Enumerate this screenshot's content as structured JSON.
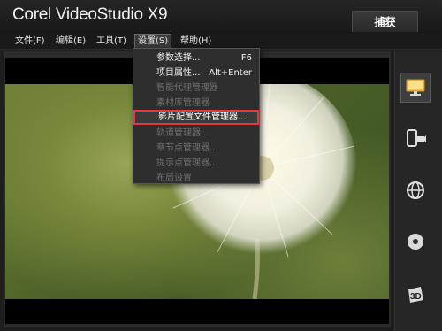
{
  "app": {
    "title": "Corel VideoStudio X9"
  },
  "tabs": {
    "capture": "捕获"
  },
  "menubar": {
    "file": "文件(F)",
    "edit": "编辑(E)",
    "tools": "工具(T)",
    "settings": "设置(S)",
    "help": "帮助(H)"
  },
  "settings_menu": {
    "items": [
      {
        "label": "参数选择...",
        "shortcut": "F6",
        "enabled": true
      },
      {
        "label": "项目属性...",
        "shortcut": "Alt+Enter",
        "enabled": true
      },
      {
        "label": "智能代理管理器",
        "shortcut": "",
        "enabled": false
      },
      {
        "label": "素材库管理器",
        "shortcut": "",
        "enabled": false
      },
      {
        "label": "影片配置文件管理器...",
        "shortcut": "",
        "enabled": true,
        "highlighted": true
      },
      {
        "label": "轨道管理器...",
        "shortcut": "",
        "enabled": false
      },
      {
        "label": "章节点管理器...",
        "shortcut": "",
        "enabled": false
      },
      {
        "label": "提示点管理器...",
        "shortcut": "",
        "enabled": false
      },
      {
        "label": "布局设置",
        "shortcut": "",
        "enabled": false
      }
    ]
  },
  "sidebar": {
    "items": [
      {
        "icon": "monitor-icon",
        "selected": true
      },
      {
        "icon": "mobile-device-icon",
        "selected": false
      },
      {
        "icon": "globe-icon",
        "selected": false
      },
      {
        "icon": "disc-icon",
        "selected": false
      },
      {
        "icon": "3d-icon",
        "label": "3D",
        "selected": false
      }
    ]
  },
  "colors": {
    "accent_highlight": "#e0393e",
    "menu_bg": "#2e2e2e",
    "window_bg": "#1e1e1e"
  }
}
